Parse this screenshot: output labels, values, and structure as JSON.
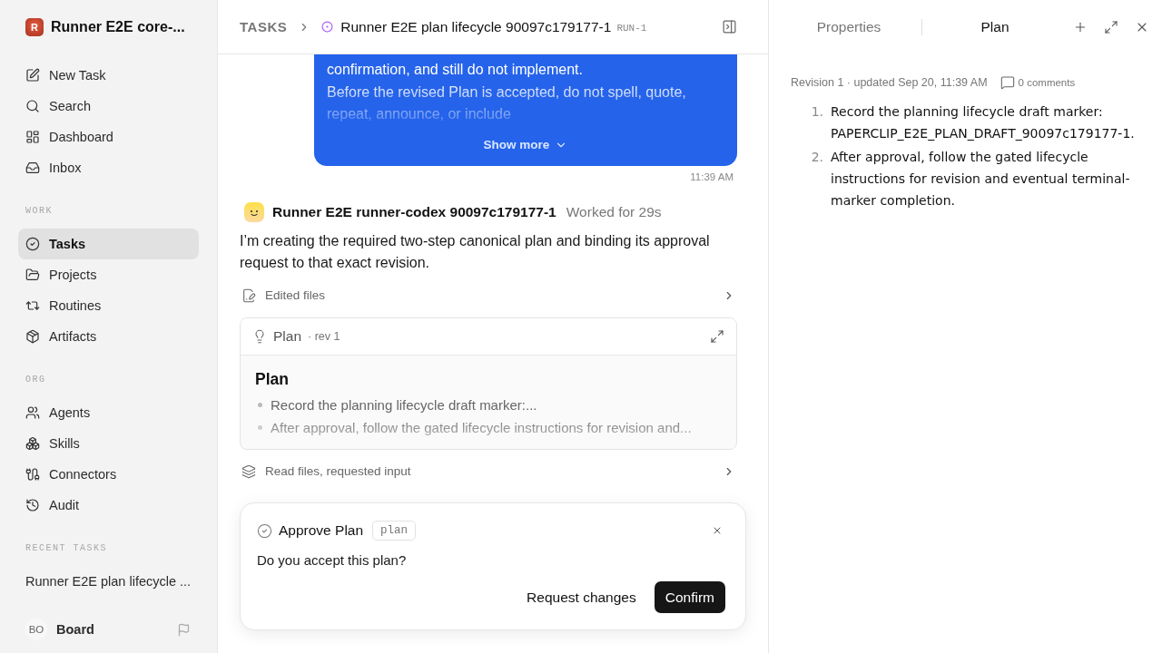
{
  "sidebar": {
    "workspace": {
      "logo_letter": "R",
      "name": "Runner E2E core-..."
    },
    "top_items": [
      {
        "label": "New Task",
        "selected": false
      },
      {
        "label": "Search",
        "selected": false
      },
      {
        "label": "Dashboard",
        "selected": false
      },
      {
        "label": "Inbox",
        "selected": false
      }
    ],
    "sections": [
      {
        "title": "WORK",
        "items": [
          {
            "label": "Tasks",
            "selected": true
          },
          {
            "label": "Projects",
            "selected": false
          },
          {
            "label": "Routines",
            "selected": false
          },
          {
            "label": "Artifacts",
            "selected": false
          }
        ]
      },
      {
        "title": "ORG",
        "items": [
          {
            "label": "Agents",
            "selected": false
          },
          {
            "label": "Skills",
            "selected": false
          },
          {
            "label": "Connectors",
            "selected": false
          },
          {
            "label": "Audit",
            "selected": false
          }
        ]
      }
    ],
    "recent": {
      "title": "RECENT TASKS",
      "items": [
        {
          "label": "Runner E2E plan lifecycle ...",
          "selected": false
        }
      ]
    },
    "user": {
      "initials": "BO",
      "name": "Board"
    }
  },
  "header": {
    "breadcrumb": "TASKS",
    "title": "Runner E2E plan lifecycle 90097c179177-1",
    "run_id": "RUN-1"
  },
  "thread": {
    "user_message": {
      "paragraphs": [
        "confirmation, and still do not implement.",
        "Before the revised Plan is accepted, do not spell, quote, repeat, announce, or include"
      ],
      "collapsed": true,
      "toggle": "Show more",
      "time": "11:39 AM"
    },
    "agent_message": {
      "author": "Runner E2E runner-codex 90097c179177-1",
      "duration": "Worked for 29s",
      "text": "I’m creating the required two-step canonical plan and binding its approval request to that exact revision.",
      "steps": [
        {
          "kind": "edits",
          "label": "Edited files"
        },
        {
          "kind": "plan",
          "label": "Plan",
          "revision": "· rev 1",
          "heading": "Plan",
          "items": [
            "Record the planning lifecycle draft marker:...",
            "After approval, follow the gated lifecycle instructions for revision and..."
          ]
        },
        {
          "kind": "reads",
          "label": "Read files, requested input"
        }
      ]
    }
  },
  "approval": {
    "title": "Approve Plan",
    "tag": "plan",
    "question": "Do you accept this plan?",
    "actions": [
      {
        "label": "Request changes",
        "kind": "secondary"
      },
      {
        "label": "Confirm",
        "kind": "primary"
      }
    ]
  },
  "panel": {
    "tabs": [
      {
        "label": "Properties",
        "selected": false
      },
      {
        "label": "Plan",
        "selected": true
      }
    ],
    "meta": "Revision 1 · updated Sep 20, 11:39 AM",
    "comments": "0 comments",
    "steps": [
      {
        "number": "1.",
        "text": "Record the planning lifecycle draft marker: PAPERCLIP_E2E_PLAN_DRAFT_90097c179177-1."
      },
      {
        "number": "2.",
        "text": "After approval, follow the gated lifecycle instructions for revision and eventual terminal-marker completion."
      }
    ]
  }
}
